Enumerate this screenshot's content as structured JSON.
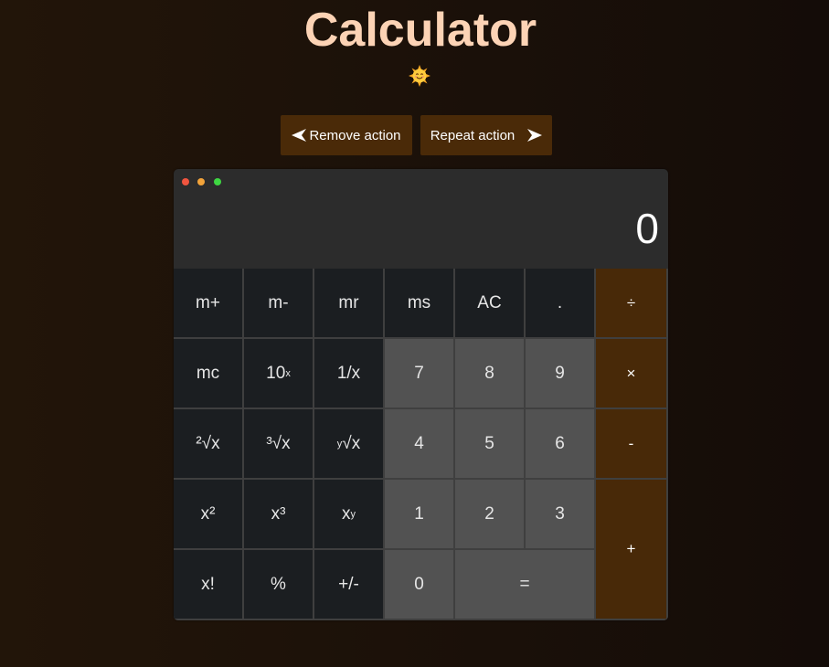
{
  "app": {
    "title": "Calculator",
    "icon": "smiling-sun-emoji"
  },
  "actions": {
    "remove_label": "Remove action",
    "repeat_label": "Repeat action"
  },
  "display": {
    "value": "0"
  },
  "keys": {
    "m_plus": "m+",
    "m_minus": "m-",
    "mr": "mr",
    "ms": "ms",
    "ac": "AC",
    "dot": ".",
    "divide": "÷",
    "mc": "mc",
    "ten_pow_base": "10",
    "ten_pow_exp": "x",
    "reciprocal": "1/x",
    "seven": "7",
    "eight": "8",
    "nine": "9",
    "multiply": "×",
    "sqrt2": "²√x",
    "sqrt3": "³√x",
    "root_y_pre": "y",
    "root_y_main": "√x",
    "four": "4",
    "five": "5",
    "six": "6",
    "minus": "-",
    "square": "x²",
    "cube": "x³",
    "pow_y_base": "x",
    "pow_y_exp": "y",
    "one": "1",
    "two": "2",
    "three": "3",
    "plus": "+",
    "factorial": "x!",
    "percent": "%",
    "negate": "+/-",
    "zero": "0",
    "equals": "="
  },
  "colors": {
    "title": "#fcd3b5",
    "operator_bg": "#482908",
    "function_bg": "#1b1e21",
    "number_bg": "#525252",
    "action_button_bg": "#4a2a08"
  }
}
